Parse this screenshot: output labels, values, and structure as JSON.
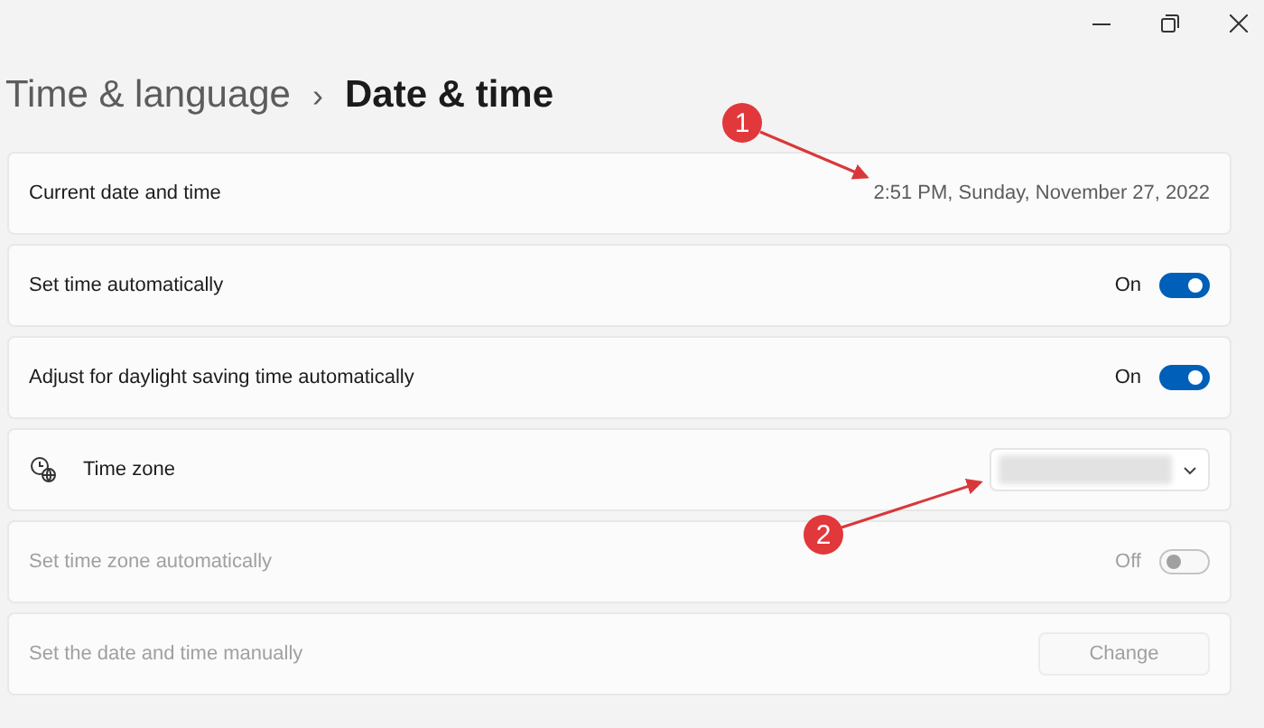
{
  "breadcrumb": {
    "parent": "Time & language",
    "separator": "›",
    "current": "Date & time"
  },
  "rows": [
    {
      "kind": "text",
      "label": "Current date and time",
      "value": "2:51 PM, Sunday, November 27, 2022",
      "disabled": false
    },
    {
      "kind": "toggle",
      "label": "Set time automatically",
      "state_text": "On",
      "on": true,
      "disabled": false
    },
    {
      "kind": "toggle",
      "label": "Adjust for daylight saving time automatically",
      "state_text": "On",
      "on": true,
      "disabled": false
    },
    {
      "kind": "dropdown",
      "label": "Time zone",
      "disabled": false
    },
    {
      "kind": "toggle",
      "label": "Set time zone automatically",
      "state_text": "Off",
      "on": false,
      "disabled": true
    },
    {
      "kind": "button",
      "label": "Set the date and time manually",
      "button": "Change",
      "disabled": true
    }
  ],
  "annotations": [
    {
      "label": "1"
    },
    {
      "label": "2"
    }
  ]
}
